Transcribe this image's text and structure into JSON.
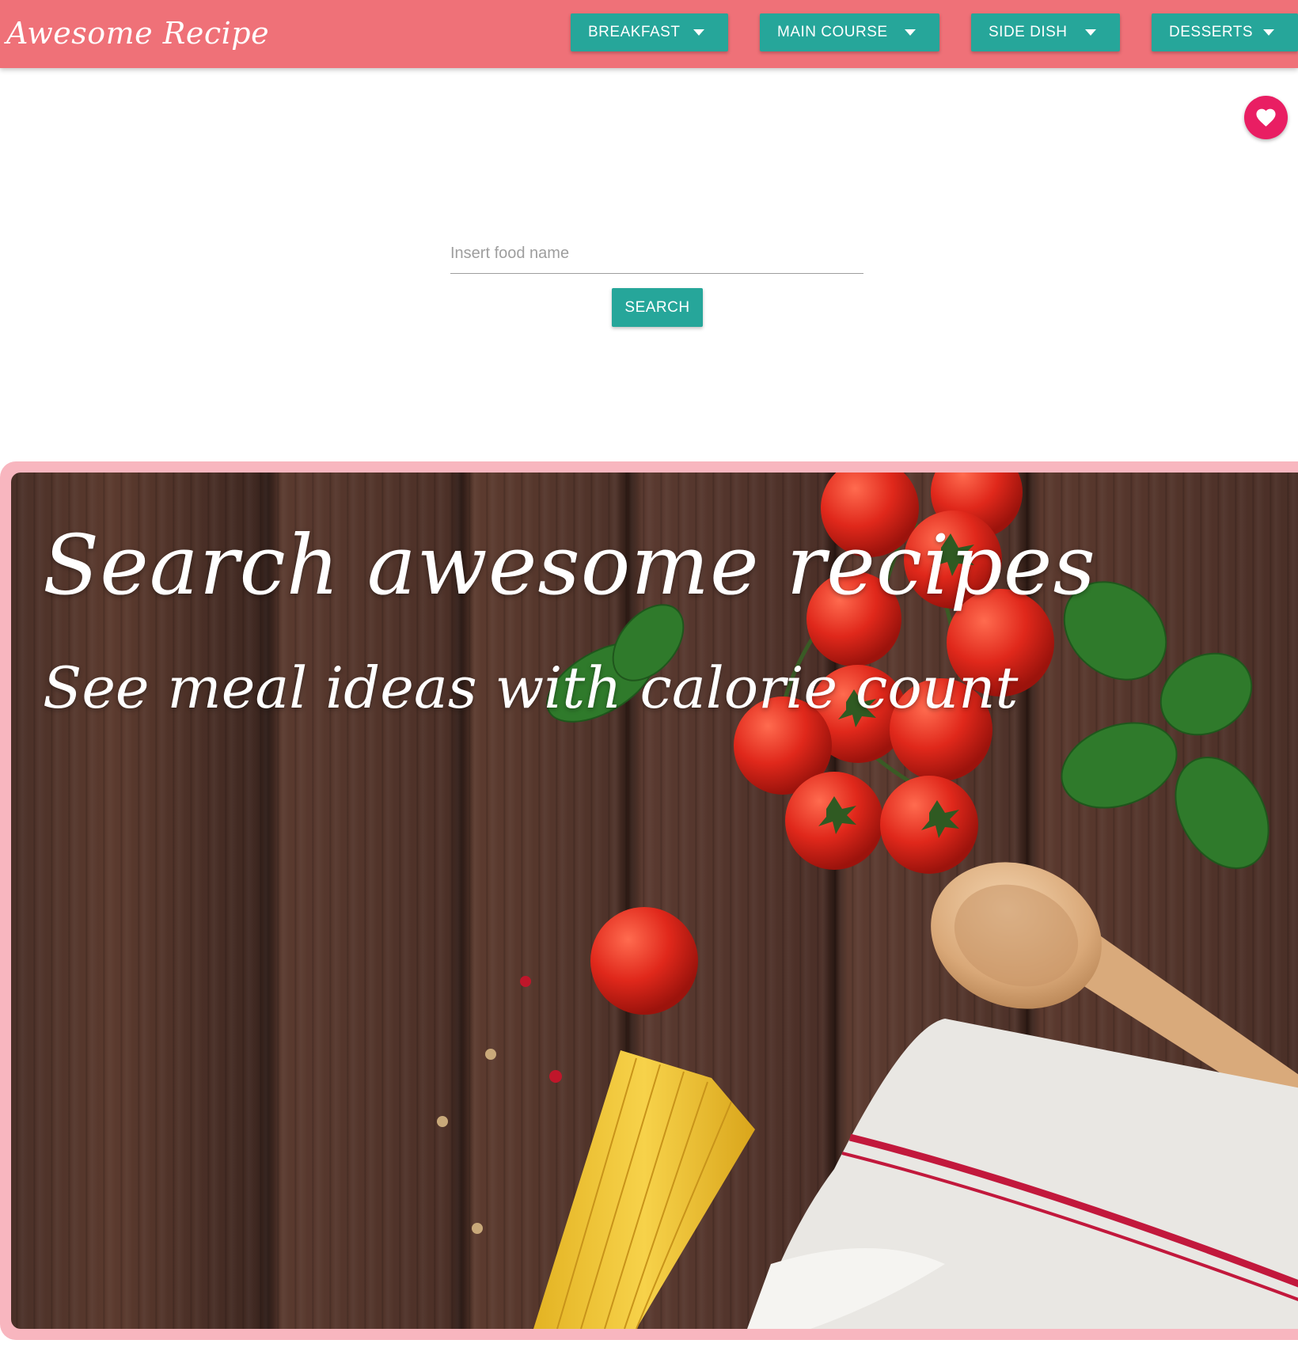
{
  "header": {
    "brand": "Awesome Recipe",
    "nav": [
      {
        "label": "BREAKFAST"
      },
      {
        "label": "MAIN COURSE"
      },
      {
        "label": "SIDE DISH"
      },
      {
        "label": "DESSERTS"
      }
    ],
    "icons": {
      "dropdown": "caret-down-icon"
    },
    "colors": {
      "header_bg": "#ef7178",
      "button_bg": "#26a69a"
    }
  },
  "favorites": {
    "icon": "heart-icon",
    "color": "#e91e63"
  },
  "search": {
    "placeholder": "Insert food name",
    "value": "",
    "button_label": "SEARCH"
  },
  "hero": {
    "title": "Search awesome recipes",
    "subtitle": "See meal ideas with calorie count",
    "frame_color": "#f8b6bf"
  }
}
